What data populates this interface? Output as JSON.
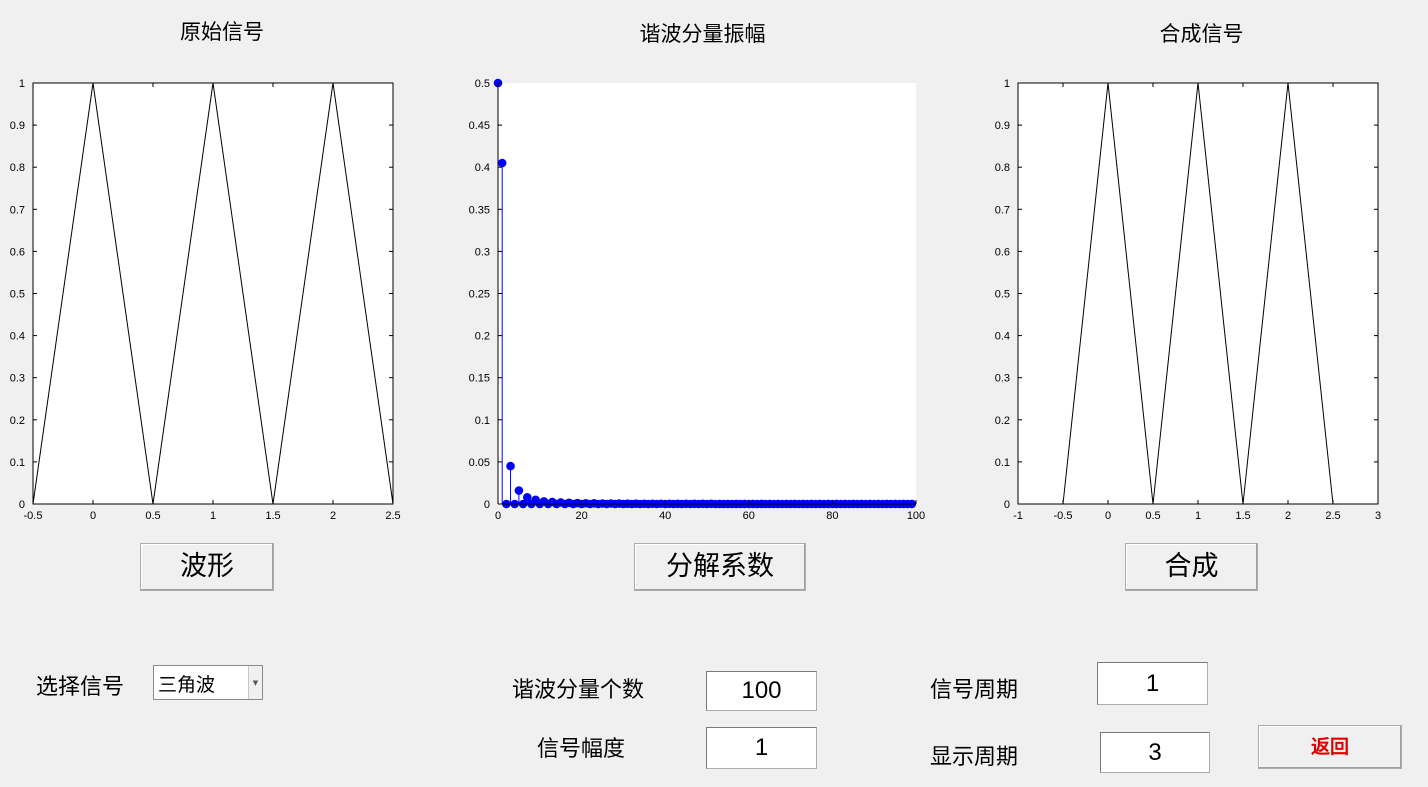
{
  "titles": {
    "original": "原始信号",
    "harmonics": "谐波分量振幅",
    "synth": "合成信号"
  },
  "buttons": {
    "waveform": "波形",
    "decompose": "分解系数",
    "synthesize": "合成",
    "back": "返回"
  },
  "controls": {
    "select_label": "选择信号",
    "select_value": "三角波",
    "harmonics_count_label": "谐波分量个数",
    "harmonics_count_value": "100",
    "amplitude_label": "信号幅度",
    "amplitude_value": "1",
    "period_label": "信号周期",
    "period_value": "1",
    "display_period_label": "显示周期",
    "display_period_value": "3"
  },
  "colors": {
    "stem": "#0000ff",
    "line": "#000000",
    "back_text": "#e00000"
  },
  "chart_data": [
    {
      "type": "line",
      "x": [
        -0.5,
        0,
        0.5,
        1,
        1.5,
        2,
        2.5
      ],
      "y": [
        0,
        1,
        0,
        1,
        0,
        1,
        0
      ],
      "xlim": [
        -0.5,
        2.5
      ],
      "ylim": [
        0,
        1
      ],
      "xticks": [
        "-0.5",
        "0",
        "0.5",
        "1",
        "1.5",
        "2",
        "2.5"
      ],
      "yticks": [
        "0",
        "0.1",
        "0.2",
        "0.3",
        "0.4",
        "0.5",
        "0.6",
        "0.7",
        "0.8",
        "0.9",
        "1"
      ],
      "title": "原始信号",
      "xlabel": "",
      "ylabel": ""
    },
    {
      "type": "stem",
      "x": [
        0,
        1,
        2,
        3,
        4,
        5,
        6,
        7,
        8,
        9,
        10,
        11,
        12,
        13,
        14,
        15,
        16,
        17,
        18,
        19,
        20,
        21,
        22,
        23,
        24,
        25,
        26,
        27,
        28,
        29,
        30,
        31,
        32,
        33,
        34,
        35,
        36,
        37,
        38,
        39,
        40,
        41,
        42,
        43,
        44,
        45,
        46,
        47,
        48,
        49,
        50,
        51,
        52,
        53,
        54,
        55,
        56,
        57,
        58,
        59,
        60,
        61,
        62,
        63,
        64,
        65,
        66,
        67,
        68,
        69,
        70,
        71,
        72,
        73,
        74,
        75,
        76,
        77,
        78,
        79,
        80,
        81,
        82,
        83,
        84,
        85,
        86,
        87,
        88,
        89,
        90,
        91,
        92,
        93,
        94,
        95,
        96,
        97,
        98,
        99
      ],
      "y": [
        0.5,
        0.405,
        0,
        0.045,
        0,
        0.016,
        0,
        0.008,
        0,
        0.005,
        0,
        0.003,
        0,
        0.0024,
        0,
        0.0018,
        0,
        0.0014,
        0,
        0.0011,
        0,
        0.0009,
        0,
        0.0008,
        0,
        0.0006,
        0,
        0.0006,
        0,
        0.0005,
        0,
        0.0004,
        0,
        0.0004,
        0,
        0.0003,
        0,
        0.0003,
        0,
        0.0003,
        0,
        0.0002,
        0,
        0.0002,
        0,
        0.0002,
        0,
        0.0002,
        0,
        0.0002,
        0,
        0.0002,
        0,
        0.0001,
        0,
        0.0001,
        0,
        0.0001,
        0,
        0.0001,
        0,
        0.0001,
        0,
        0.0001,
        0,
        0.0001,
        0,
        0.0001,
        0,
        0.0001,
        0,
        0.0001,
        0,
        0.0001,
        0,
        0.0001,
        0,
        0.0001,
        0,
        0.0001,
        0,
        0.0001,
        0,
        0.0001,
        0,
        0.0001,
        0,
        0.0001,
        0,
        0.0001,
        0,
        0.0001,
        0,
        0.0001,
        0,
        0.0001,
        0,
        0.0001,
        0,
        0.0001
      ],
      "xlim": [
        0,
        100
      ],
      "ylim": [
        0,
        0.5
      ],
      "xticks": [
        "0",
        "20",
        "40",
        "60",
        "80",
        "100"
      ],
      "yticks": [
        "0",
        "0.05",
        "0.1",
        "0.15",
        "0.2",
        "0.25",
        "0.3",
        "0.35",
        "0.4",
        "0.45",
        "0.5"
      ],
      "title": "谐波分量振幅",
      "xlabel": "",
      "ylabel": ""
    },
    {
      "type": "line",
      "x": [
        -0.5,
        0,
        0.5,
        1,
        1.5,
        2,
        2.5
      ],
      "y": [
        0,
        1,
        0,
        1,
        0,
        1,
        0
      ],
      "xlim": [
        -1,
        3
      ],
      "ylim": [
        0,
        1
      ],
      "xticks": [
        "-1",
        "-0.5",
        "0",
        "0.5",
        "1",
        "1.5",
        "2",
        "2.5",
        "3"
      ],
      "yticks": [
        "0",
        "0.1",
        "0.2",
        "0.3",
        "0.4",
        "0.5",
        "0.6",
        "0.7",
        "0.8",
        "0.9",
        "1"
      ],
      "title": "合成信号",
      "xlabel": "",
      "ylabel": ""
    }
  ]
}
